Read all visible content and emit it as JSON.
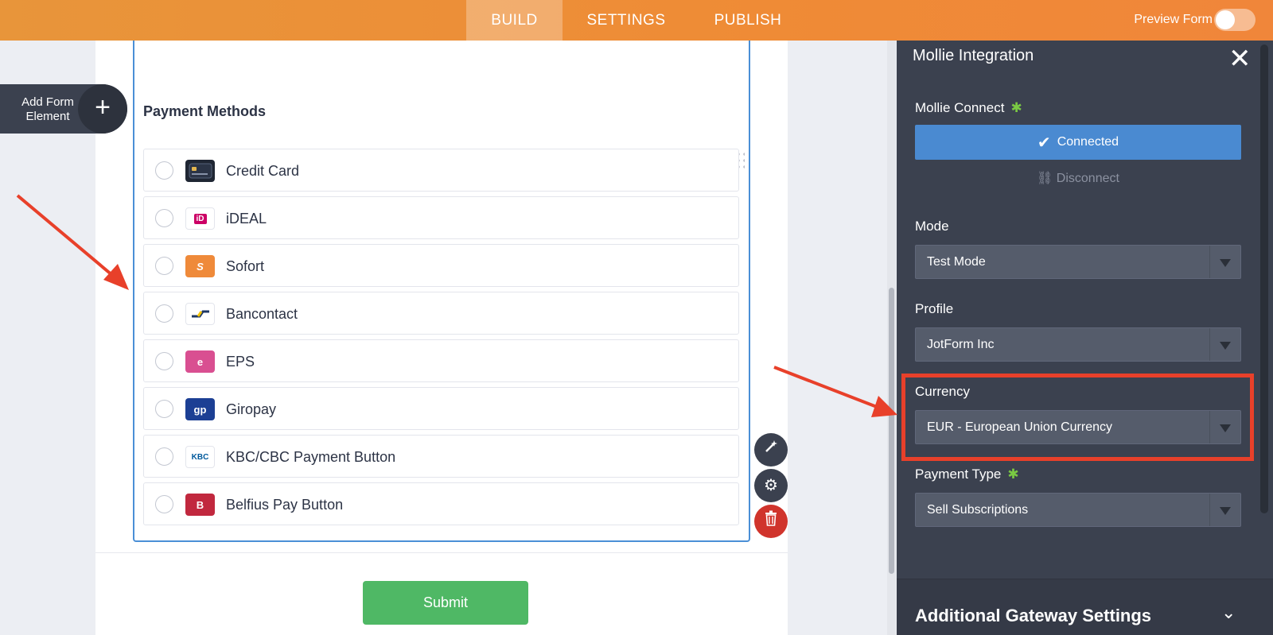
{
  "topbar": {
    "tabs": [
      {
        "label": "BUILD",
        "active": true
      },
      {
        "label": "SETTINGS",
        "active": false
      },
      {
        "label": "PUBLISH",
        "active": false
      }
    ],
    "preview_label": "Preview Form"
  },
  "sidebar": {
    "add_element_label": "Add Form Element",
    "add_icon": "plus-icon"
  },
  "form": {
    "section_title": "Payment Methods",
    "payment_methods": [
      {
        "label": "Credit Card",
        "icon": "credit-card-icon",
        "color": "#1f2633"
      },
      {
        "label": "iDEAL",
        "icon": "ideal-icon",
        "color": "#cc0066"
      },
      {
        "label": "Sofort",
        "icon": "sofort-icon",
        "color": "#ef8a3a"
      },
      {
        "label": "Bancontact",
        "icon": "bancontact-icon",
        "color": "#1e3764"
      },
      {
        "label": "EPS",
        "icon": "eps-icon",
        "color": "#d94f91"
      },
      {
        "label": "Giropay",
        "icon": "giropay-icon",
        "color": "#1c3f94"
      },
      {
        "label": "KBC/CBC Payment Button",
        "icon": "kbc-icon",
        "color": "#00599c"
      },
      {
        "label": "Belfius Pay Button",
        "icon": "belfius-icon",
        "color": "#c1283e"
      }
    ],
    "submit_label": "Submit",
    "logo_text": {
      "ideal": "iD",
      "sofort": "S",
      "bancontact": "",
      "eps": "e",
      "giropay": "gp",
      "kbc": "KBC",
      "belfius": "B"
    }
  },
  "tools": [
    "wand-icon",
    "gear-icon",
    "trash-icon"
  ],
  "panel": {
    "title": "Mollie Integration",
    "connect_label": "Mollie Connect",
    "connected_label": "Connected",
    "disconnect_label": "Disconnect",
    "mode_label": "Mode",
    "mode_value": "Test Mode",
    "profile_label": "Profile",
    "profile_value": "JotForm Inc",
    "currency_label": "Currency",
    "currency_value": "EUR - European Union Currency",
    "payment_type_label": "Payment Type",
    "payment_type_value": "Sell Subscriptions",
    "additional_label": "Additional Gateway Settings"
  },
  "colors": {
    "accent": "#ef8b36",
    "panel": "#3b414f",
    "highlight": "#e8402a",
    "submit": "#4fb865",
    "connected": "#4a8ad1"
  }
}
